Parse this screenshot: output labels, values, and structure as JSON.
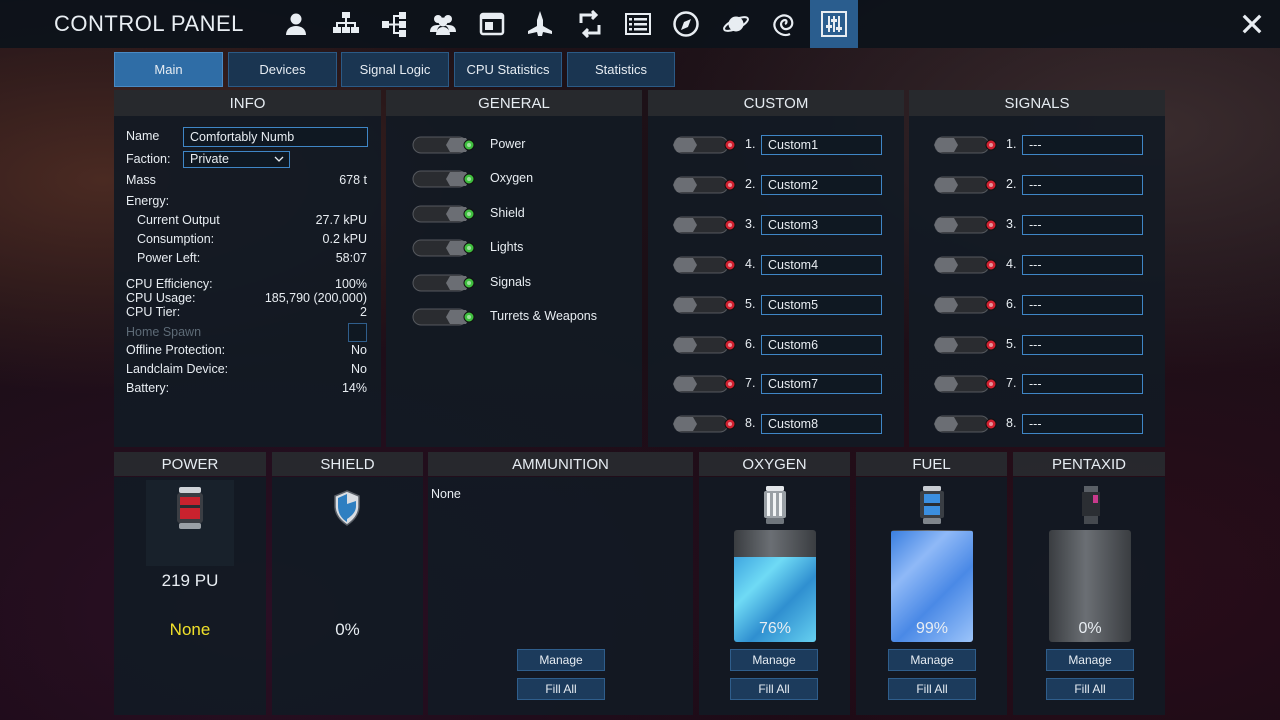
{
  "header": {
    "title": "CONTROL PANEL",
    "icons": [
      "player-icon",
      "structure-icon",
      "network-icon",
      "faction-icon",
      "window-icon",
      "ship-icon",
      "transfer-icon",
      "list-icon",
      "compass-icon",
      "planet-icon",
      "galaxy-icon",
      "sliders-icon"
    ],
    "close_label": "✕"
  },
  "tabs": [
    {
      "label": "Main",
      "active": true
    },
    {
      "label": "Devices"
    },
    {
      "label": "Signal Logic"
    },
    {
      "label": "CPU Statistics"
    },
    {
      "label": "Statistics"
    }
  ],
  "info": {
    "heading": "INFO",
    "name_label": "Name",
    "name_value": "Comfortably Numb",
    "faction_label": "Faction:",
    "faction_value": "Private",
    "mass_label": "Mass",
    "mass_value": "678 t",
    "energy_label": "Energy:",
    "current_output_label": "Current Output",
    "current_output_value": "27.7 kPU",
    "consumption_label": "Consumption:",
    "consumption_value": "0.2 kPU",
    "power_left_label": "Power Left:",
    "power_left_value": "58:07",
    "cpu_eff_label": "CPU Efficiency:",
    "cpu_eff_value": "100%",
    "cpu_usage_label": "CPU Usage:",
    "cpu_usage_value": "185,790  (200,000)",
    "cpu_tier_label": "CPU Tier:",
    "cpu_tier_value": "2",
    "home_spawn_label": "Home Spawn",
    "offline_label": "Offline Protection:",
    "offline_value": "No",
    "landclaim_label": "Landclaim Device:",
    "landclaim_value": "No",
    "battery_label": "Battery:",
    "battery_value": "14%"
  },
  "general": {
    "heading": "GENERAL",
    "items": [
      "Power",
      "Oxygen",
      "Shield",
      "Lights",
      "Signals",
      "Turrets & Weapons"
    ]
  },
  "custom": {
    "heading": "CUSTOM",
    "numbers": [
      "1.",
      "2.",
      "3.",
      "4.",
      "5.",
      "6.",
      "7.",
      "8."
    ],
    "names": [
      "Custom1",
      "Custom2",
      "Custom3",
      "Custom4",
      "Custom5",
      "Custom6",
      "Custom7",
      "Custom8"
    ]
  },
  "signals": {
    "heading": "SIGNALS",
    "numbers": [
      "1.",
      "2.",
      "3.",
      "4.",
      "6.",
      "5.",
      "7.",
      "8."
    ],
    "values": [
      "---",
      "---",
      "---",
      "---",
      "---",
      "---",
      "---",
      "---"
    ]
  },
  "power": {
    "heading": "POWER",
    "value": "219 PU",
    "fuel_state": "None"
  },
  "shield": {
    "heading": "SHIELD",
    "percent": "0%"
  },
  "ammo": {
    "heading": "AMMUNITION",
    "content": "None",
    "manage": "Manage",
    "fill": "Fill All"
  },
  "oxygen": {
    "heading": "OXYGEN",
    "percent": "76%",
    "level": 0.76,
    "manage": "Manage",
    "fill": "Fill All"
  },
  "fuel": {
    "heading": "FUEL",
    "percent": "99%",
    "level": 0.99,
    "manage": "Manage",
    "fill": "Fill All"
  },
  "pentaxid": {
    "heading": "PENTAXID",
    "percent": "0%",
    "level": 0,
    "manage": "Manage",
    "fill": "Fill All"
  },
  "colors": {
    "accent": "#2f6da6",
    "on_led": "#3fbf3f",
    "off_led": "#d21f2f",
    "yellow": "#f0e02a"
  }
}
